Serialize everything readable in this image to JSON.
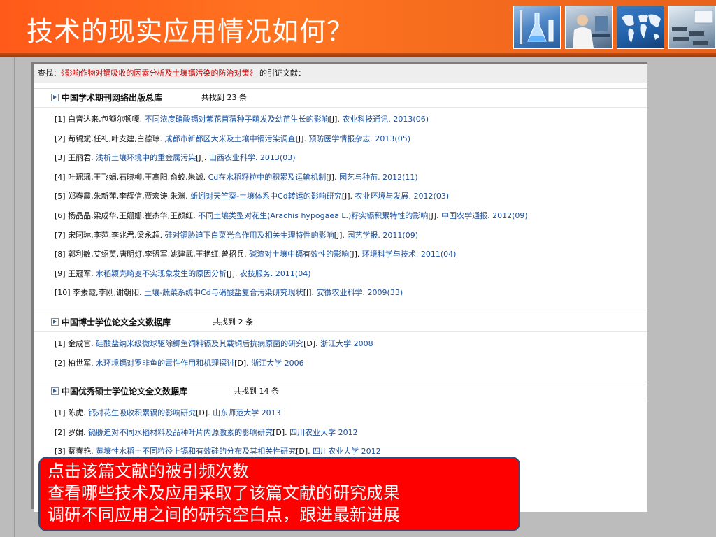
{
  "slide": {
    "title": "技术的现实应用情况如何？"
  },
  "header_images": [
    {
      "icon": "flask-icon"
    },
    {
      "icon": "scientist-icon"
    },
    {
      "icon": "world-map-icon"
    },
    {
      "icon": "classroom-icon"
    }
  ],
  "search": {
    "prefix": "查找：",
    "paper_title": "《影响作物对镉吸收的因素分析及土壤镉污染的防治对策》",
    "suffix": " 的引证文献："
  },
  "sections": [
    {
      "name": "中国学术期刊网络出版总库",
      "count": "共找到 23 条",
      "items": [
        {
          "num": "[1]",
          "authors": "白音达来,包额尔顿嘎.",
          "title": "不同浓度硝酸镉对紫花苜蓿种子萌发及幼苗生长的影响",
          "type": "[J].",
          "source": "农业科技通讯. 2013(06)"
        },
        {
          "num": "[2]",
          "authors": "苟锡斌,任礼,叶支建,白德琼.",
          "title": "成都市新都区大米及土壤中镉污染调查",
          "type": "[J].",
          "source": "预防医学情报杂志. 2013(05)"
        },
        {
          "num": "[3]",
          "authors": "王丽君.",
          "title": "浅析土壤环境中的重金属污染",
          "type": "[J].",
          "source": "山西农业科学. 2013(03)"
        },
        {
          "num": "[4]",
          "authors": "叶瑶瑶,王飞娟,石晓柳,王高阳,俞蛟,朱诚.",
          "title": "Cd在水稻籽粒中的积累及运输机制",
          "type": "[J].",
          "source": "园艺与种苗. 2012(11)"
        },
        {
          "num": "[5]",
          "authors": "郑春霞,朱新萍,李辉信,贾宏涛,朱渊.",
          "title": "蚯蚓对天竺葵-土壤体系中Cd转运的影响研究",
          "type": "[J].",
          "source": "农业环境与发展. 2012(03)"
        },
        {
          "num": "[6]",
          "authors": "杨晶晶,梁成华,王姗姗,崔杰华,王颜红.",
          "title": "不同土壤类型对花生(Arachis hypogaea L.)籽实镉积累特性的影响",
          "type": "[J].",
          "source": "中国农学通报. 2012(09)"
        },
        {
          "num": "[7]",
          "authors": "宋阿琳,李萍,李兆君,梁永超.",
          "title": "硅对镉胁迫下白菜光合作用及相关生理特性的影响",
          "type": "[J].",
          "source": "园艺学报. 2011(09)"
        },
        {
          "num": "[8]",
          "authors": "郭利敏,艾绍英,唐明灯,李盟军,姚建武,王艳红,曾招兵.",
          "title": "碱渣对土壤中镉有效性的影响",
          "type": "[J].",
          "source": "环境科学与技术. 2011(04)"
        },
        {
          "num": "[9]",
          "authors": "王冠军.",
          "title": "水稻颖壳畸变不实现象发生的原因分析",
          "type": "[J].",
          "source": "农技服务. 2011(04)"
        },
        {
          "num": "[10]",
          "authors": "李素霞,李刚,谢朝阳.",
          "title": "土壤-蔬菜系统中Cd与硝酸盐复合污染研究现状",
          "type": "[J].",
          "source": "安徽农业科学. 2009(33)"
        }
      ]
    },
    {
      "name": "中国博士学位论文全文数据库",
      "count": "共找到 2 条",
      "items": [
        {
          "num": "[1]",
          "authors": "金成官.",
          "title": "硅酸盐纳米级微球驱除鲫鱼饲料镉及其载铜后抗病原菌的研究",
          "type": "[D].",
          "source": "浙江大学 2008"
        },
        {
          "num": "[2]",
          "authors": "柏世军.",
          "title": "水环境镉对罗非鱼的毒性作用和机理探讨",
          "type": "[D].",
          "source": "浙江大学 2006"
        }
      ]
    },
    {
      "name": "中国优秀硕士学位论文全文数据库",
      "count": "共找到 14 条",
      "items": [
        {
          "num": "[1]",
          "authors": "陈虎.",
          "title": "钙对花生吸收积累镉的影响研究",
          "type": "[D].",
          "source": "山东师范大学 2013"
        },
        {
          "num": "[2]",
          "authors": "罗娟.",
          "title": "镉胁迫对不同水稻材料及品种叶片内源激素的影响研究",
          "type": "[D].",
          "source": "四川农业大学 2012"
        },
        {
          "num": "[3]",
          "authors": "蔡春艳.",
          "title": "黄壤性水稻土不同粒径上镉和有效硅的分布及其相关性研究",
          "type": "[D].",
          "source": "四川农业大学 2012"
        }
      ]
    }
  ],
  "callout": {
    "line1": "点击该篇文献的被引频次数",
    "line2": "查看哪些技术及应用采取了该篇文献的研究成果",
    "line3": "调研不同应用之间的研究空白点，跟进最新进展"
  }
}
